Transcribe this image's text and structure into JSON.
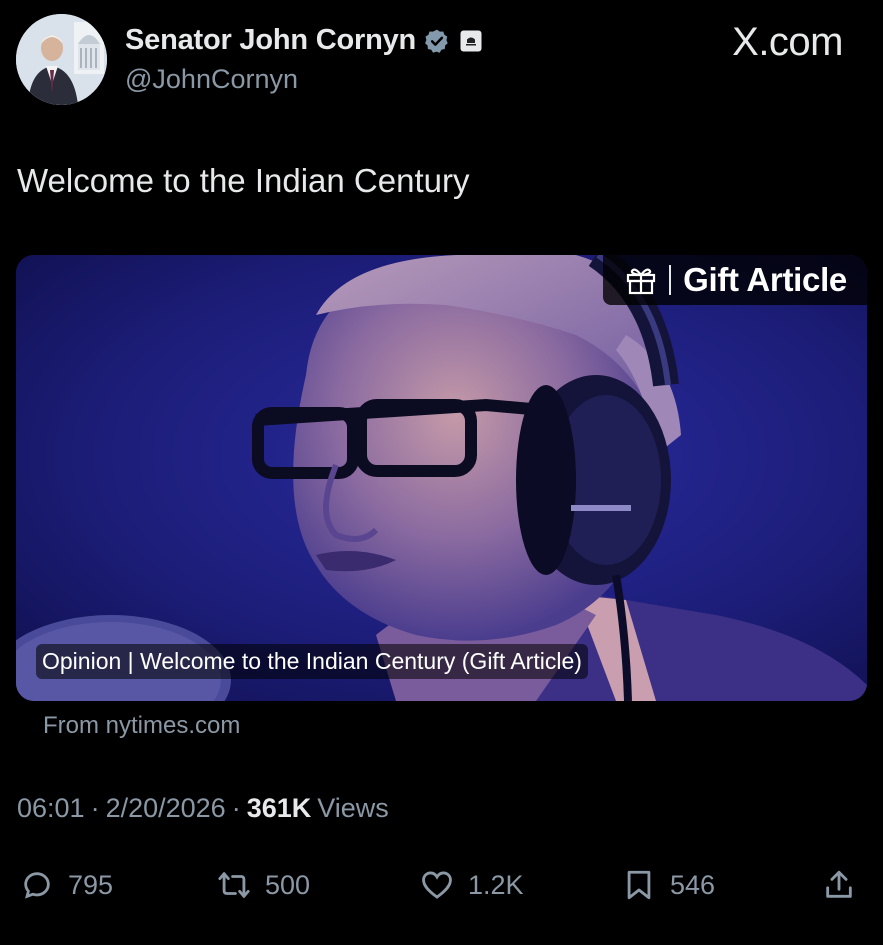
{
  "author": {
    "display_name": "Senator John Cornyn",
    "handle": "@JohnCornyn",
    "verified_icon": "verified-badge-icon",
    "gov_icon": "government-label-icon"
  },
  "watermark": "X.com",
  "tweet": {
    "text": "Welcome to the Indian Century"
  },
  "card": {
    "gift_label": "Gift Article",
    "title": "Opinion | Welcome to the Indian Century (Gift Article)",
    "source": "From nytimes.com"
  },
  "meta": {
    "time": "06:01",
    "sep1": "·",
    "date": "2/20/2026",
    "sep2": "·",
    "views_count": "361K",
    "views_label": "Views"
  },
  "actions": {
    "replies": "795",
    "reposts": "500",
    "likes": "1.2K",
    "bookmarks": "546"
  },
  "colors": {
    "background": "#000000",
    "text": "#e7e9ea",
    "secondary": "#8b98a5",
    "card_tint": "#1d1d6e"
  }
}
